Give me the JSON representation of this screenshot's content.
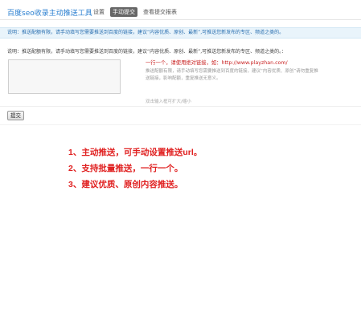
{
  "header": {
    "title": "百度seo收录主动推送工具",
    "tabs": [
      {
        "label": "设置",
        "active": false
      },
      {
        "label": "手动提交",
        "active": true
      },
      {
        "label": "查看提交报表",
        "active": false
      }
    ]
  },
  "info_bar": {
    "text": "说明：推送配额有限，请手动填写您需要推送到百度的链接，建议“内容优质、原创、最新”,可推送您新发布的专区、频道之类的。"
  },
  "form": {
    "description": "说明：推送配额有限，请手动填写您需要推送到百度的链接，建议“内容优质、原创、最新”,可推送您新发布的专区、频道之类的。：",
    "textarea_value": "",
    "hint_title": "一行一个，请使用绝对链接，如：http://www.playzhan.com/",
    "hint_text": "推送配额有限，请手动填写您需要推送到百度的链接，建议“内容优质、原创”请勿重复推送链接，影响配额，重复推送无意义。",
    "resize_hint": "双击输入框可扩大/缩小",
    "submit_label": "提交"
  },
  "features": [
    "1、主动推送，可手动设置推送url。",
    "2、支持批量推送，一行一个。",
    "3、建议优质、原创内容推送。"
  ],
  "colors": {
    "accent": "#2a7fd0",
    "active_tab": "#666666",
    "highlight_red": "#e02020"
  }
}
